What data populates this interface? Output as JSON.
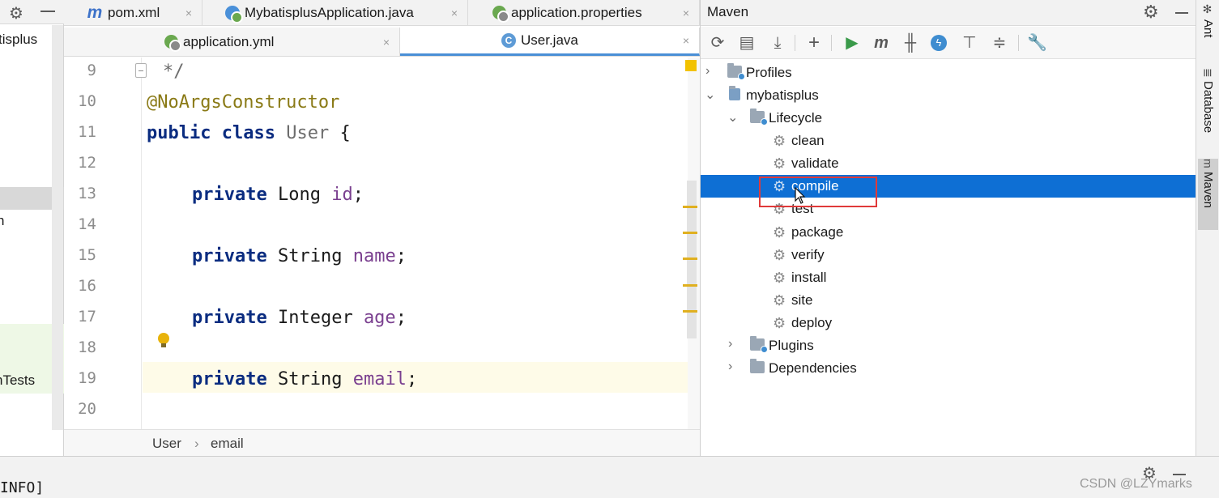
{
  "project": {
    "items": [
      {
        "label": "tisplus"
      },
      {
        "label": "n"
      },
      {
        "label": "nTests"
      }
    ]
  },
  "editor": {
    "tabs_row1": [
      {
        "label": "pom.xml",
        "icon": "maven-icon"
      },
      {
        "label": "MybatisplusApplication.java",
        "icon": "spring-boot-class-icon"
      },
      {
        "label": "application.properties",
        "icon": "spring-config-icon"
      }
    ],
    "tabs_row2": [
      {
        "label": "application.yml",
        "icon": "spring-config-icon"
      },
      {
        "label": "User.java",
        "icon": "java-class-icon",
        "active": true
      }
    ],
    "close_glyph": "×",
    "line_numbers": [
      "9",
      "10",
      "11",
      "12",
      "13",
      "14",
      "15",
      "16",
      "17",
      "18",
      "19",
      "20"
    ],
    "code": {
      "l9": "*/",
      "l10_annotation": "@NoArgsConstructor",
      "l11_kw1": "public",
      "l11_kw2": "class",
      "l11_name": "User",
      "l11_brace": "{",
      "l13_kw": "private",
      "l13_type": "Long",
      "l13_field": "id",
      "l15_kw": "private",
      "l15_type": "String",
      "l15_field": "name",
      "l17_kw": "private",
      "l17_type": "Integer",
      "l17_field": "age",
      "l19_kw": "private",
      "l19_type": "String",
      "l19_field": "email",
      "semicolon": ";"
    },
    "breadcrumb": {
      "class": "User",
      "separator": "›",
      "member": "email"
    }
  },
  "maven": {
    "title": "Maven",
    "toolbar": [
      "reload-icon",
      "generate-sources-icon",
      "download-icon",
      "add-icon",
      "run-icon",
      "execute-goal-icon",
      "skip-tests-icon",
      "offline-icon",
      "show-dependencies-icon",
      "collapse-all-icon",
      "settings-icon"
    ],
    "tree": {
      "profiles": "Profiles",
      "project": "mybatisplus",
      "lifecycle": "Lifecycle",
      "phases": [
        "clean",
        "validate",
        "compile",
        "test",
        "package",
        "verify",
        "install",
        "site",
        "deploy"
      ],
      "selected_phase": "compile",
      "plugins": "Plugins",
      "dependencies": "Dependencies"
    }
  },
  "right_tabs": [
    "Ant",
    "Database",
    "Maven"
  ],
  "bottom": {
    "log_text": "INFO]",
    "watermark": "CSDN @LZYmarks"
  },
  "colors": {
    "selection": "#0e6fd4",
    "highlight_box": "#e03a3a",
    "keyword": "#0a2c80",
    "annotation": "#8a7a16",
    "field": "#7a3f8f"
  }
}
